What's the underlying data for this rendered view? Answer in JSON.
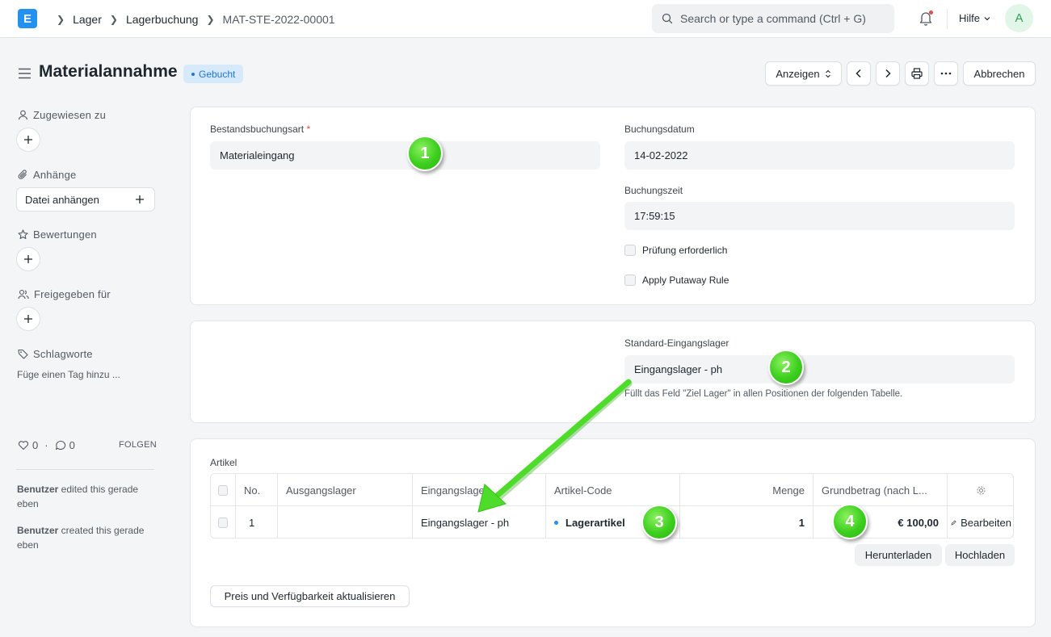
{
  "navbar": {
    "logo": "E",
    "breadcrumbs": [
      "Lager",
      "Lagerbuchung",
      "MAT-STE-2022-00001"
    ],
    "search_placeholder": "Search or type a command (Ctrl + G)",
    "help_label": "Hilfe",
    "avatar_initial": "A"
  },
  "page": {
    "title": "Materialannahme",
    "status": "Gebucht",
    "actions": {
      "view_label": "Anzeigen",
      "cancel_label": "Abbrechen"
    }
  },
  "sidebar": {
    "assigned_label": "Zugewiesen zu",
    "attachments_label": "Anhänge",
    "attach_button": "Datei anhängen",
    "ratings_label": "Bewertungen",
    "shared_label": "Freigegeben für",
    "tags_label": "Schlagworte",
    "tag_hint": "Füge einen Tag hinzu ...",
    "likes": "0",
    "comments": "0",
    "follow_label": "FOLGEN",
    "activity": [
      {
        "user": "Benutzer",
        "text": " edited this gerade eben"
      },
      {
        "user": "Benutzer",
        "text": " created this gerade eben"
      }
    ]
  },
  "form": {
    "entry_type_label": "Bestandsbuchungsart",
    "entry_type_value": "Materialeingang",
    "posting_date_label": "Buchungsdatum",
    "posting_date_value": "14-02-2022",
    "posting_time_label": "Buchungszeit",
    "posting_time_value": "17:59:15",
    "inspection_label": "Prüfung erforderlich",
    "putaway_label": "Apply Putaway Rule",
    "target_wh_label": "Standard-Eingangslager",
    "target_wh_value": "Eingangslager - ph",
    "target_wh_help": "Füllt das Feld \"Ziel Lager\" in allen Positionen der folgenden Tabelle."
  },
  "items": {
    "section_label": "Artikel",
    "columns": [
      "No.",
      "Ausgangslager",
      "Eingangslager",
      "Artikel-Code",
      "Menge",
      "Grundbetrag (nach L..."
    ],
    "rows": [
      {
        "no": "1",
        "source": "",
        "target": "Eingangslager - ph",
        "item_code": "Lagerartikel",
        "qty": "1",
        "amount": "€ 100,00",
        "edit": "Bearbeiten"
      }
    ],
    "download_label": "Herunterladen",
    "upload_label": "Hochladen",
    "update_rate_label": "Preis und Verfügbarkeit aktualisieren"
  },
  "annotations": {
    "markers": [
      "1",
      "2",
      "3",
      "4"
    ],
    "arrow_color": "#4ddc2a"
  },
  "colors": {
    "accent": "#2490ef",
    "status_bg": "#d6eafc",
    "status_text": "#2074d4"
  }
}
